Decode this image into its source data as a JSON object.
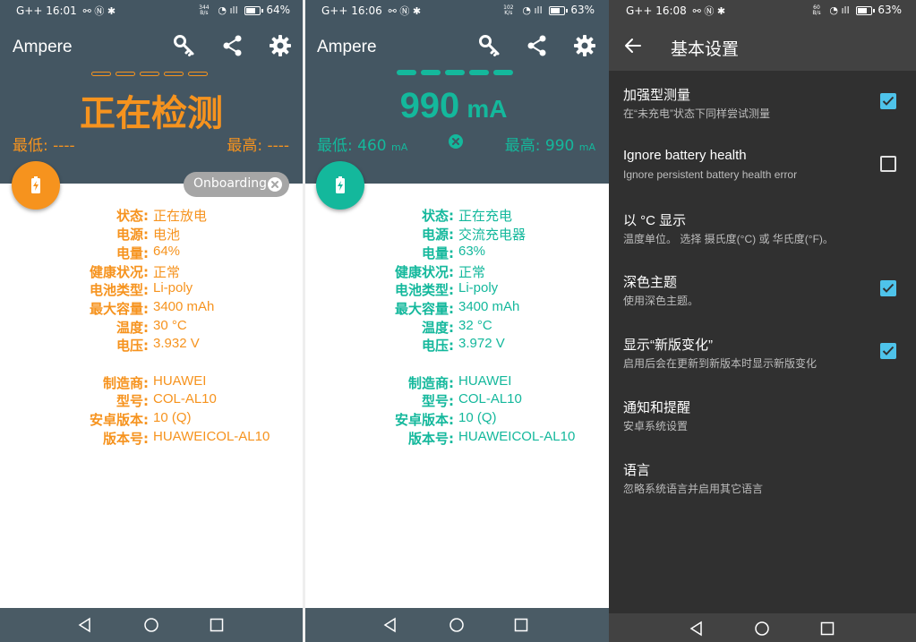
{
  "colors": {
    "orange": "#f6931e",
    "teal": "#14b89c",
    "header_bg": "#445662",
    "settings_bg": "#303030",
    "checkbox_on": "#4ec3ea"
  },
  "panels": [
    {
      "status": {
        "time": "G++ 16:01",
        "speed_top": "344",
        "speed_bottom": "B/s",
        "battery": "64%",
        "battery_level": 0.64
      },
      "app_title": "Ampere",
      "reading": "正在检测",
      "reading_unit": "",
      "min_label": "最低: ----",
      "min_unit": "",
      "max_label": "最高: ----",
      "max_unit": "",
      "chip_label": "Onboarding",
      "info": [
        {
          "label": "状态:",
          "value": "正在放电"
        },
        {
          "label": "电源:",
          "value": "电池"
        },
        {
          "label": "电量:",
          "value": "64%"
        },
        {
          "label": "健康状况:",
          "value": "正常"
        },
        {
          "label": "电池类型:",
          "value": "Li-poly"
        },
        {
          "label": "最大容量:",
          "value": "3400 mAh"
        },
        {
          "label": "温度:",
          "value": "30 °C"
        },
        {
          "label": "电压:",
          "value": "3.932 V"
        }
      ],
      "device": [
        {
          "label": "制造商:",
          "value": "HUAWEI"
        },
        {
          "label": "型号:",
          "value": "COL-AL10"
        },
        {
          "label": "安卓版本:",
          "value": "10 (Q)"
        },
        {
          "label": "版本号:",
          "value": "HUAWEICOL-AL10"
        }
      ]
    },
    {
      "status": {
        "time": "G++ 16:06",
        "speed_top": "102",
        "speed_bottom": "K/s",
        "battery": "63%",
        "battery_level": 0.63
      },
      "app_title": "Ampere",
      "reading": "990",
      "reading_unit": "mA",
      "min_label": "最低: 460",
      "min_unit": "mA",
      "max_label": "最高: 990",
      "max_unit": "mA",
      "info": [
        {
          "label": "状态:",
          "value": "正在充电"
        },
        {
          "label": "电源:",
          "value": "交流充电器"
        },
        {
          "label": "电量:",
          "value": "63%"
        },
        {
          "label": "健康状况:",
          "value": "正常"
        },
        {
          "label": "电池类型:",
          "value": "Li-poly"
        },
        {
          "label": "最大容量:",
          "value": "3400 mAh"
        },
        {
          "label": "温度:",
          "value": "32 °C"
        },
        {
          "label": "电压:",
          "value": "3.972 V"
        }
      ],
      "device": [
        {
          "label": "制造商:",
          "value": "HUAWEI"
        },
        {
          "label": "型号:",
          "value": "COL-AL10"
        },
        {
          "label": "安卓版本:",
          "value": "10 (Q)"
        },
        {
          "label": "版本号:",
          "value": "HUAWEICOL-AL10"
        }
      ]
    }
  ],
  "settings": {
    "status": {
      "time": "G++ 16:08",
      "speed_top": "60",
      "speed_bottom": "B/s",
      "battery": "63%",
      "battery_level": 0.63
    },
    "title": "基本设置",
    "items": [
      {
        "title": "加强型测量",
        "subtitle": "在“未充电”状态下同样尝试测量",
        "checked": true
      },
      {
        "title": "Ignore battery health",
        "subtitle": "Ignore persistent battery health error",
        "checked": false
      },
      {
        "title": "以 °C 显示",
        "subtitle": "温度单位。 选择 摄氏度(°C) 或 华氏度(°F)。"
      },
      {
        "title": "深色主题",
        "subtitle": "使用深色主题。",
        "checked": true
      },
      {
        "title": "显示“新版变化”",
        "subtitle": "启用后会在更新到新版本时显示新版变化",
        "checked": true
      },
      {
        "title": "通知和提醒",
        "subtitle": "安卓系统设置"
      },
      {
        "title": "语言",
        "subtitle": "忽略系统语言并启用其它语言"
      }
    ]
  }
}
